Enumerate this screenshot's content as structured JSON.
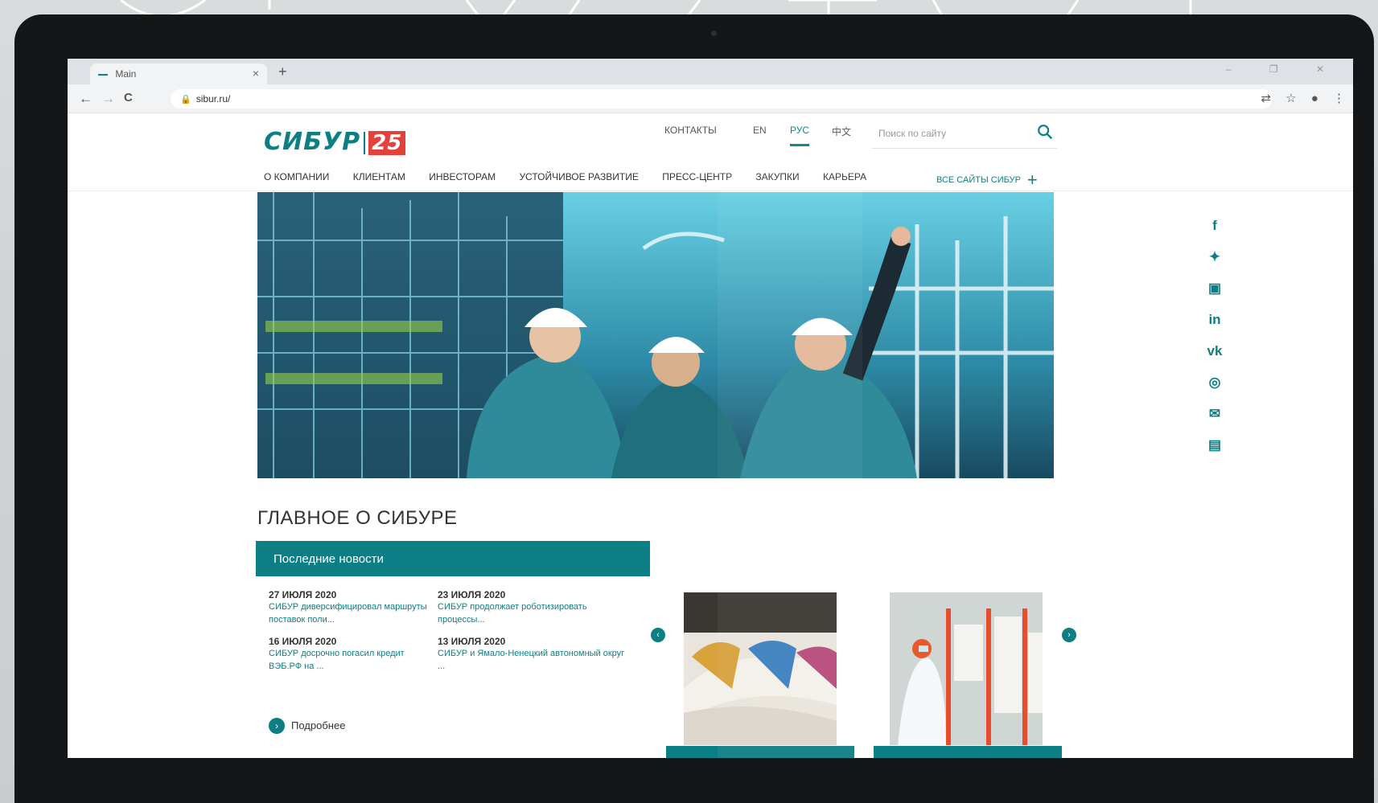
{
  "browser": {
    "tab_title": "Main",
    "tab_close": "×",
    "new_tab": "+",
    "url": "sibur.ru/",
    "nav": {
      "back": "←",
      "forward": "→",
      "reload": "C"
    },
    "window_controls": "– ❐ ✕",
    "icons": [
      "translate-icon",
      "star-icon",
      "profile-icon",
      "menu-icon"
    ]
  },
  "site": {
    "logo_text": "СИБУР",
    "logo_number": "25",
    "top_links": {
      "contacts": "КОНТАКТЫ",
      "en": "EN",
      "ru": "РУС",
      "zh": "中文"
    },
    "search_placeholder": "Поиск по сайту",
    "menu": [
      "О КОМПАНИИ",
      "КЛИЕНТАМ",
      "ИНВЕСТОРАМ",
      "УСТОЙЧИВОЕ РАЗВИТИЕ",
      "ПРЕСС-ЦЕНТР",
      "ЗАКУПКИ",
      "КАРЬЕРА"
    ],
    "all_sites": "ВСЕ САЙТЫ СИБУР",
    "socials": [
      "f",
      "t",
      "yt",
      "in",
      "vk",
      "ig",
      "mail",
      "print"
    ],
    "section_title": "ГЛАВНОЕ О СИБУРЕ",
    "news": {
      "header": "Последние новости",
      "items": [
        {
          "date": "27 ИЮЛЯ 2020",
          "text": "СИБУР диверсифицировал маршруты поставок поли..."
        },
        {
          "date": "23 ИЮЛЯ 2020",
          "text": "СИБУР продолжает роботизировать процессы..."
        },
        {
          "date": "16 ИЮЛЯ 2020",
          "text": "СИБУР досрочно погасил кредит ВЭБ.РФ на ..."
        },
        {
          "date": "13 ИЮЛЯ 2020",
          "text": "СИБУР и Ямало-Ненецкий автономный округ ..."
        }
      ],
      "more": "Подробнее"
    }
  },
  "colors": {
    "brand": "#0b7f84",
    "accent": "#e5403a"
  }
}
